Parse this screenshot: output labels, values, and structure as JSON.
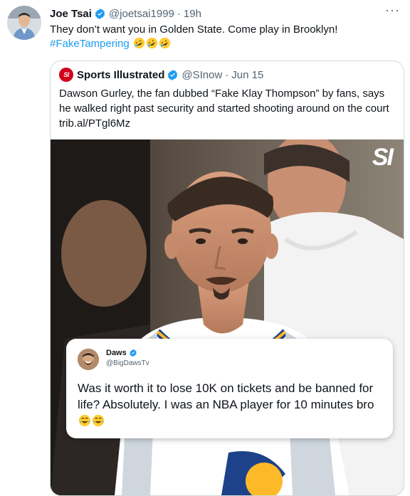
{
  "tweet": {
    "author_name": "Joe Tsai",
    "handle": "@joetsai1999",
    "separator": "·",
    "time": "19h",
    "more_label": "···",
    "text_line1": "They don’t want you in Golden State. Come play in Brooklyn!",
    "hashtag": "#FakeTampering",
    "emojis": [
      "rolling-on-floor-laughing",
      "rolling-on-floor-laughing",
      "rolling-on-floor-laughing"
    ]
  },
  "quote": {
    "author_name": "Sports Illustrated",
    "logo_text": "SI",
    "handle": "@SInow",
    "separator": "·",
    "date": "Jun 15",
    "text": "Dawson Gurley, the fan dubbed “Fake Klay Thompson” by fans, says he walked right past security and started shooting around on the court trib.al/PTgl6Mz",
    "media_watermark": "SI",
    "embedded_card": {
      "name": "Daws",
      "handle": "@BigDawsTv",
      "text": "Was it worth it to lose 10K on tickets and be banned for life? Absolutely. I was an NBA player for 10 minutes bro",
      "emojis": [
        "face-with-tears-of-joy",
        "face-with-tears-of-joy"
      ]
    }
  },
  "colors": {
    "verified": "#1d9bf0",
    "hashtag": "#1d9bf0",
    "si_red": "#d0021b"
  }
}
